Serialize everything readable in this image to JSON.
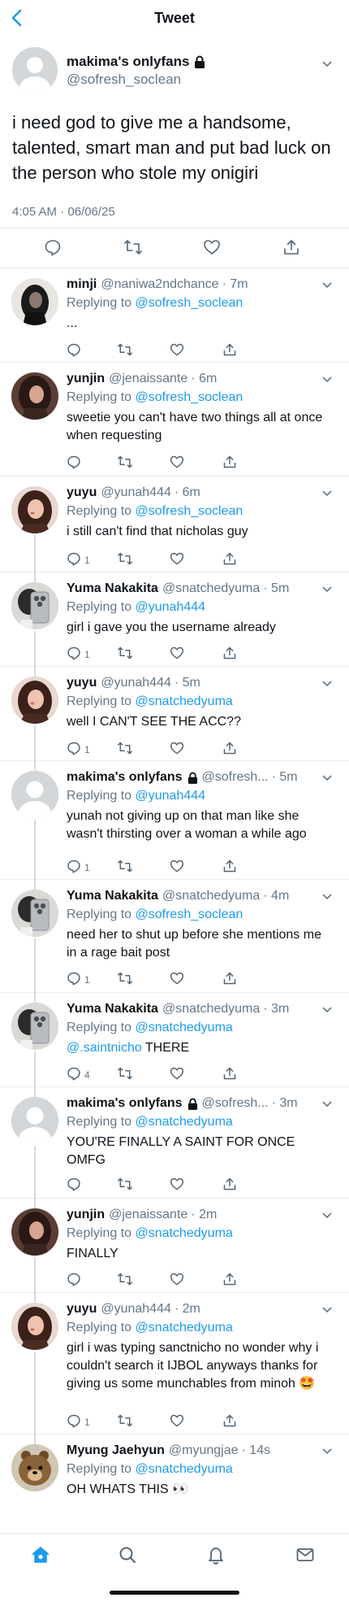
{
  "header": {
    "title": "Tweet",
    "back_icon": "back-chevron-icon"
  },
  "main_tweet": {
    "display_name": "makima's onlyfans",
    "handle": "@sofresh_soclean",
    "text": "i need god to give me a handsome, talented, smart man and put bad luck on the person who stole my onigiri",
    "timestamp": "4:05 AM · 06/06/25"
  },
  "replies": [
    {
      "name": "minji",
      "handle": "@naniwa2ndchance",
      "time": "· 7m",
      "replying_label": "Replying to",
      "replying_to": "@sofresh_soclean",
      "text": "...",
      "reply_count": "",
      "avatar": "dark"
    },
    {
      "name": "yunjin",
      "handle": "@jenaissante",
      "time": "· 6m",
      "replying_label": "Replying to",
      "replying_to": "@sofresh_soclean",
      "text": "sweetie you can't have two things all at once when requesting",
      "reply_count": "",
      "avatar": "girl-dark"
    },
    {
      "name": "yuyu",
      "handle": "@yunah444",
      "time": "· 6m",
      "replying_label": "Replying to",
      "replying_to": "@sofresh_soclean",
      "text": "i still can't find that nicholas guy",
      "reply_count": "1",
      "avatar": "girl"
    },
    {
      "name": "Yuma Nakakita",
      "handle": "@snatchedyuma",
      "time": "· 5m",
      "replying_label": "Replying to",
      "replying_to": "@yunah444",
      "text": "girl i gave you the username already",
      "reply_count": "1",
      "avatar": "phone"
    },
    {
      "name": "yuyu",
      "handle": "@yunah444",
      "time": "· 5m",
      "replying_label": "Replying to",
      "replying_to": "@snatchedyuma",
      "text": "well I CAN'T SEE THE ACC??",
      "reply_count": "1",
      "avatar": "girl"
    },
    {
      "name": "makima's onlyfans",
      "handle": "@sofresh...",
      "time": "· 5m",
      "replying_label": "Replying to",
      "replying_to": "@yunah444",
      "text": "yunah not giving up on that man like she wasn't thirsting over a woman a while ago",
      "reply_count": "1",
      "avatar": "default",
      "locked": true
    },
    {
      "name": "Yuma Nakakita",
      "handle": "@snatchedyuma",
      "time": "· 4m",
      "replying_label": "Replying to",
      "replying_to": "@sofresh_soclean",
      "text": "need her to shut up before she mentions me in a rage bait post",
      "reply_count": "1",
      "avatar": "phone"
    },
    {
      "name": "Yuma Nakakita",
      "handle": "@snatchedyuma",
      "time": "· 3m",
      "replying_label": "Replying to",
      "replying_to": "@snatchedyuma",
      "text_mention": "@.saintnicho",
      "text": " THERE",
      "reply_count": "4",
      "avatar": "phone"
    },
    {
      "name": "makima's onlyfans",
      "handle": "@sofresh...",
      "time": "· 3m",
      "replying_label": "Replying to",
      "replying_to": "@snatchedyuma",
      "text": "YOU'RE FINALLY A SAINT FOR ONCE OMFG",
      "reply_count": "",
      "avatar": "default",
      "locked": true
    },
    {
      "name": "yunjin",
      "handle": "@jenaissante",
      "time": "· 2m",
      "replying_label": "Replying to",
      "replying_to": "@snatchedyuma",
      "text": "FINALLY",
      "reply_count": "",
      "avatar": "girl-dark"
    },
    {
      "name": "yuyu",
      "handle": "@yunah444",
      "time": "· 2m",
      "replying_label": "Replying to",
      "replying_to": "@snatchedyuma",
      "text": "girl i was typing sanctnicho no wonder why i couldn't search it IJBOL anyways thanks for giving us some munchables from minoh 🤩",
      "reply_count": "1",
      "avatar": "girl"
    },
    {
      "name": "Myung Jaehyun",
      "handle": "@myungjae",
      "time": "· 14s",
      "replying_label": "Replying to",
      "replying_to": "@snatchedyuma",
      "text": "OH WHATS THIS 👀",
      "reply_count": "",
      "avatar": "bear"
    }
  ],
  "tabbar": {
    "items": [
      "home-icon",
      "search-icon",
      "notifications-icon",
      "messages-icon"
    ]
  },
  "colors": {
    "accent": "#1d9bf0",
    "secondary_text": "#657786",
    "divider": "#e6ecf0"
  }
}
